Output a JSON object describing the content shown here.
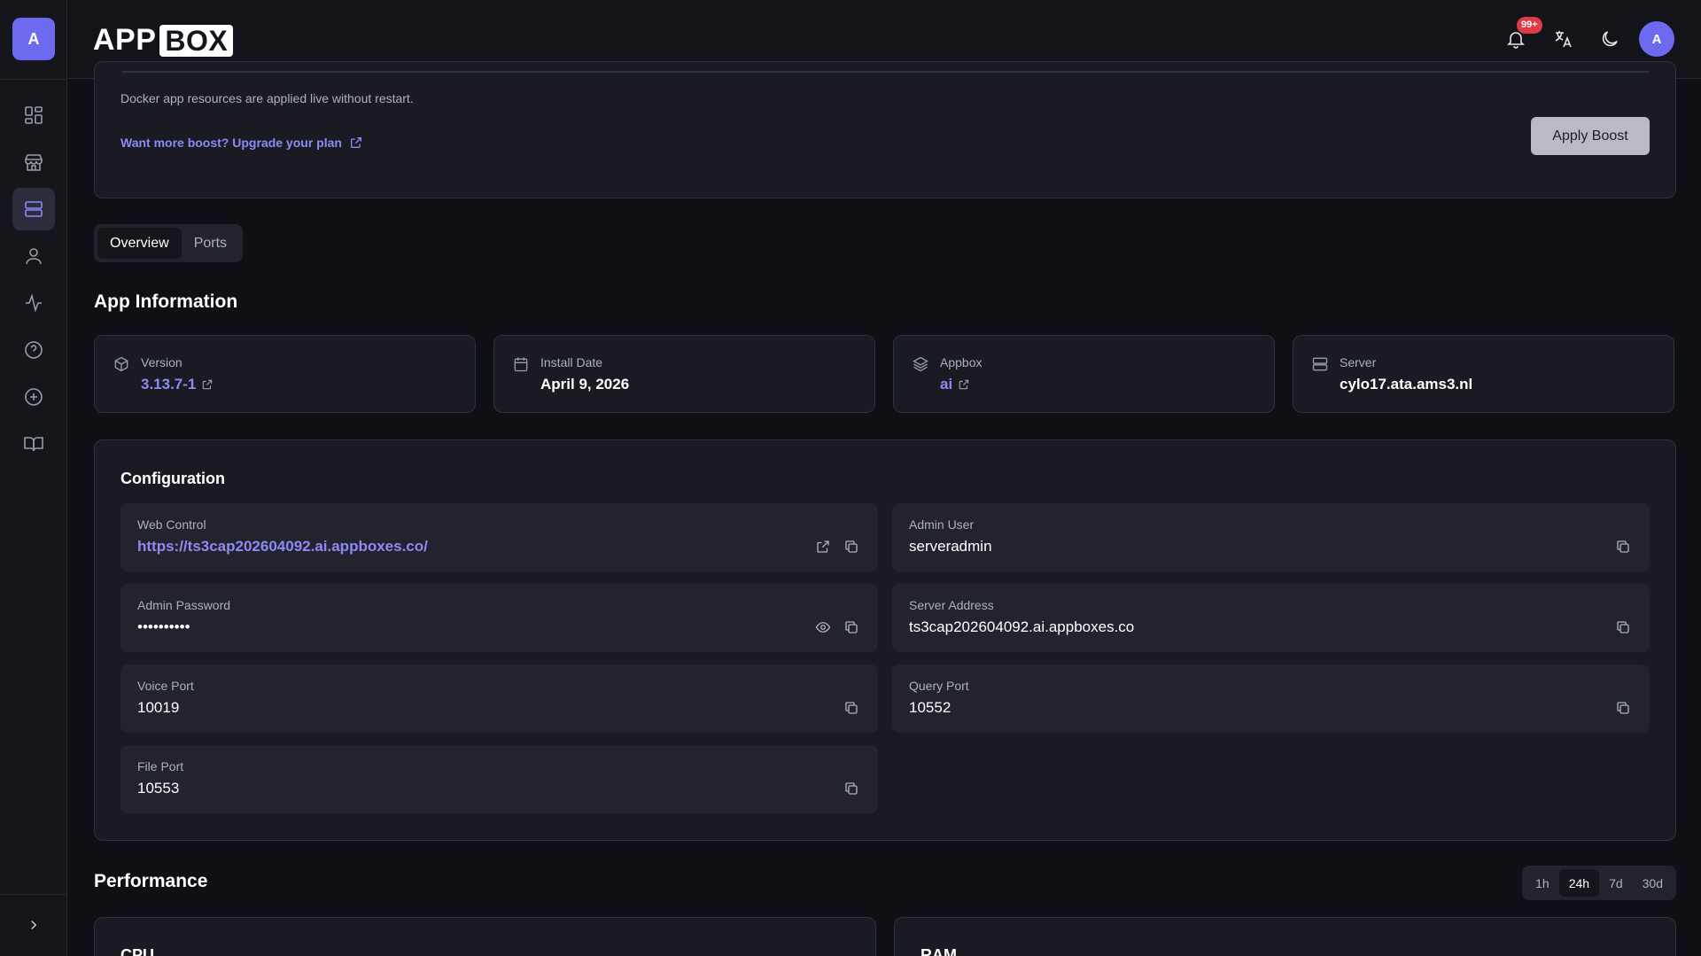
{
  "sidebar": {
    "avatar_letter": "A",
    "items": [
      {
        "icon": "dashboard-icon"
      },
      {
        "icon": "store-icon"
      },
      {
        "icon": "server-icon",
        "active": true
      },
      {
        "icon": "user-icon"
      },
      {
        "icon": "activity-icon"
      },
      {
        "icon": "help-icon"
      },
      {
        "icon": "add-circle-icon"
      },
      {
        "icon": "book-icon"
      }
    ],
    "collapse_icon": "chevron-right-icon"
  },
  "header": {
    "logo_app": "APP",
    "logo_box": "BOX",
    "notifications_badge": "99+",
    "user_initial": "A"
  },
  "boost": {
    "note": "Docker app resources are applied live without restart.",
    "upgrade_link": "Want more boost? Upgrade your plan",
    "apply_label": "Apply Boost"
  },
  "tabs": [
    {
      "label": "Overview",
      "active": true
    },
    {
      "label": "Ports",
      "active": false
    }
  ],
  "app_info": {
    "title": "App Information",
    "cards": [
      {
        "label": "Version",
        "value": "3.13.7-1",
        "icon": "package-icon",
        "link": true
      },
      {
        "label": "Install Date",
        "value": "April 9, 2026",
        "icon": "calendar-icon",
        "link": false
      },
      {
        "label": "Appbox",
        "value": "ai",
        "icon": "layers-icon",
        "link": true
      },
      {
        "label": "Server",
        "value": "cylo17.ata.ams3.nl",
        "icon": "server-icon",
        "link": false
      }
    ]
  },
  "configuration": {
    "title": "Configuration",
    "fields": [
      {
        "label": "Web Control",
        "value": "https://ts3cap202604092.ai.appboxes.co/"
      },
      {
        "label": "Admin User",
        "value": "serveradmin"
      },
      {
        "label": "Admin Password",
        "value": "••••••••••"
      },
      {
        "label": "Server Address",
        "value": "ts3cap202604092.ai.appboxes.co"
      },
      {
        "label": "Voice Port",
        "value": "10019"
      },
      {
        "label": "Query Port",
        "value": "10552"
      },
      {
        "label": "File Port",
        "value": "10553"
      }
    ]
  },
  "performance": {
    "title": "Performance",
    "ranges": [
      {
        "label": "1h",
        "active": false
      },
      {
        "label": "24h",
        "active": true
      },
      {
        "label": "7d",
        "active": false
      },
      {
        "label": "30d",
        "active": false
      }
    ],
    "cards": [
      "CPU",
      "RAM"
    ]
  },
  "colors": {
    "accent": "#8c8af7",
    "avatar": "#6d6af0",
    "badge": "#e03a44"
  }
}
